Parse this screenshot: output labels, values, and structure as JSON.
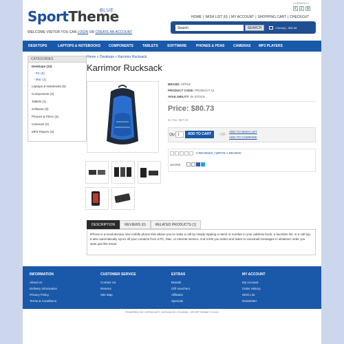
{
  "header": {
    "logo_main": "SportTheme",
    "logo_sub": "BLUE",
    "welcome": "WELCOME VISITOR YOU CAN",
    "login": "LOGIN",
    "or": "OR",
    "create": "CREATE AN ACCOUNT",
    "currency_label": "CURRENCY",
    "currencies": [
      "€",
      "£",
      "$"
    ],
    "top_links": [
      "HOME",
      "WISH LIST (0)",
      "MY ACCOUNT",
      "SHOPPING CART",
      "CHECKOUT"
    ],
    "search_value": "Search",
    "search_button": "SEARCH",
    "cart_text": "1 item(s) - $25.48"
  },
  "nav": [
    "DESKTOPS",
    "LAPTOPS & NOTEBOOKS",
    "COMPONENTS",
    "TABLETS",
    "SOFTWARE",
    "PHONES & PDAS",
    "CAMERAS",
    "MP3 PLAYERS"
  ],
  "sidebar": {
    "title": "CATEGORIES",
    "items": [
      "Desktops (12)",
      "- PC (0)",
      "- Mac (1)",
      "Laptops & Notebooks (5)",
      "Components (2)",
      "Tablets (1)",
      "Software (0)",
      "Phones & PDAs (3)",
      "Cameras (2)",
      "MP3 Players (4)"
    ]
  },
  "breadcrumb": [
    "Home",
    "Desktops",
    "Karrimor Rucksack"
  ],
  "product": {
    "title": "Karrimor Rucksack",
    "brand_label": "BRAND:",
    "brand": "APPLE",
    "code_label": "PRODUCT CODE:",
    "code": "PRODUCT 11",
    "avail_label": "AVAILABILITY:",
    "avail": "IN STOCK",
    "price": "Price: $80.73",
    "ex_tax": "Ex Tax: $67.00",
    "qty_label": "Qty:",
    "qty": "1",
    "add_to_cart": "ADD TO CART",
    "or": "- OR -",
    "wishlist": "ADD TO WISH LIST",
    "compare": "ADD TO COMPARE",
    "reviews": "0 REVIEWS",
    "write_review": "WRITE A REVIEW",
    "share": "SHARE"
  },
  "tabs": [
    "DESCRIPTION",
    "REVIEWS (0)",
    "RELATED PRODUCTS (1)"
  ],
  "description": "iPhone is a revolutionary new mobile phone that allows you to make a call by simply tapping a name or number in your address book, a favorites list, or a call log. It also automatically syncs all your contacts from a PC, Mac, or Internet service. And it lets you select and listen to voicemail messages in whatever order you want just like email.",
  "footer": {
    "columns": [
      {
        "title": "INFORMATION",
        "items": [
          "About Us",
          "Delivery Information",
          "Privacy Policy",
          "Terms & Conditions"
        ]
      },
      {
        "title": "CUSTOMER SERVICE",
        "items": [
          "Contact Us",
          "Returns",
          "Site Map"
        ]
      },
      {
        "title": "EXTRAS",
        "items": [
          "Brands",
          "Gift Vouchers",
          "Affiliates",
          "Specials"
        ]
      },
      {
        "title": "MY ACCOUNT",
        "items": [
          "My Account",
          "Order History",
          "Wish List",
          "Newsletter"
        ]
      }
    ],
    "copyright": "POWERED BY OPENCART. DESIGN BY OTAZNIK. SPORTTHEME © 2012"
  },
  "colors": {
    "brand_blue": "#1a59a9",
    "accent_blue": "#1b4f99",
    "background": "#ccd6ec"
  }
}
